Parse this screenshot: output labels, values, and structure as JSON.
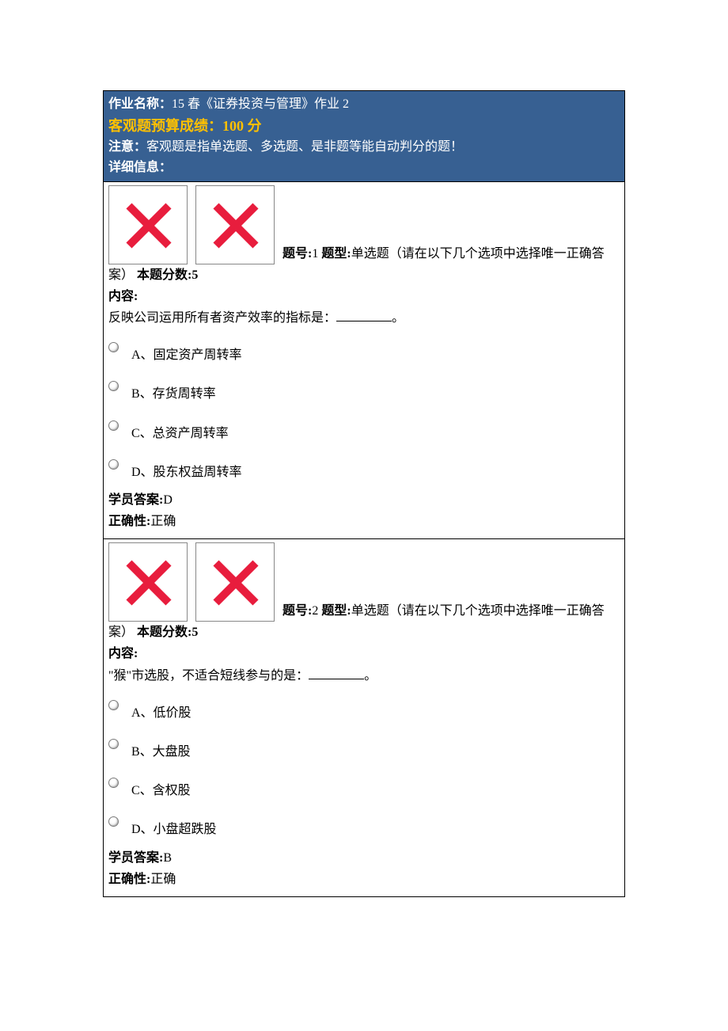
{
  "header": {
    "title_label": "作业名称：",
    "title_value": "15 春《证券投资与管理》作业 2",
    "score_label": "客观题预算成绩：",
    "score_value": "100 分",
    "note_label": "注意：",
    "note_text": "客观题是指单选题、多选题、是非题等能自动判分的题！",
    "detail_label": "详细信息："
  },
  "questions": [
    {
      "no_label": "题号:",
      "no_value": "1",
      "type_label": "题型:",
      "type_value": "单选题（请在以下几个选项中选择唯一正确答案）",
      "score_label": "本题分数:",
      "score_value": "5",
      "content_label": "内容:",
      "content_text_before": "反映公司运用所有者资产效率的指标是：",
      "content_text_after": "。",
      "options": [
        "A、固定资产周转率",
        "B、存货周转率",
        "C、总资产周转率",
        "D、股东权益周转率"
      ],
      "answer_label": "学员答案:",
      "answer_value": "D",
      "correct_label": "正确性:",
      "correct_value": "正确"
    },
    {
      "no_label": "题号:",
      "no_value": "2",
      "type_label": "题型:",
      "type_value": "单选题（请在以下几个选项中选择唯一正确答案）",
      "score_label": "本题分数:",
      "score_value": "5",
      "content_label": "内容:",
      "content_text_before": "\"猴\"市选股，不适合短线参与的是：",
      "content_text_after": "。",
      "options": [
        "A、低价股",
        "B、大盘股",
        "C、含权股",
        "D、小盘超跌股"
      ],
      "answer_label": "学员答案:",
      "answer_value": "B",
      "correct_label": "正确性:",
      "correct_value": "正确"
    }
  ]
}
